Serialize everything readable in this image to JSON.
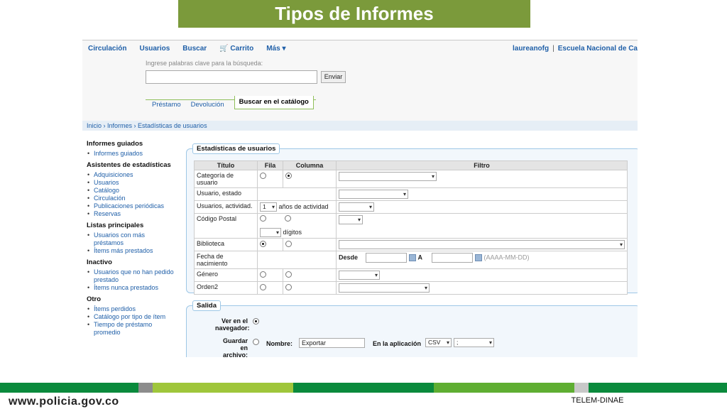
{
  "banner": {
    "title": "Tipos de Informes"
  },
  "topnav": {
    "links": [
      "Circulación",
      "Usuarios",
      "Buscar",
      "Carrito",
      "Más"
    ],
    "user": "laureanofg",
    "library": "Escuela Nacional de Ca"
  },
  "search": {
    "hint": "Ingrese palabras clave para la búsqueda:",
    "button": "Enviar",
    "tabs": [
      "Préstamo",
      "Devolución",
      "Buscar en el catálogo"
    ]
  },
  "breadcrumb": "Inicio › Informes › Estadísticas de usuarios",
  "sidebar": {
    "sections": [
      {
        "title": "Informes guiados",
        "items": [
          "Informes guiados"
        ]
      },
      {
        "title": "Asistentes de estadísticas",
        "items": [
          "Adquisiciones",
          "Usuarios",
          "Catálogo",
          "Circulación",
          "Publicaciones periódicas",
          "Reservas"
        ]
      },
      {
        "title": "Listas principales",
        "items": [
          "Usuarios con más",
          "préstamos",
          "Ítems más prestados"
        ]
      },
      {
        "title": "Inactivo",
        "items": [
          "Usuarios que no han pedido",
          "prestado",
          "Ítems nunca prestados"
        ]
      },
      {
        "title": "Otro",
        "items": [
          "Ítems perdidos",
          "Catálogo por tipo de ítem",
          "Tiempo de préstamo",
          "promedio"
        ]
      }
    ]
  },
  "stats": {
    "legend": "Estadísticas de usuarios",
    "headers": [
      "Título",
      "Fila",
      "Columna",
      "Filtro"
    ],
    "rows": {
      "categoria": "Categoría de usuario",
      "estado": "Usuario, estado",
      "actividad": "Usuarios, actividad.",
      "actividad_sel": "1",
      "actividad_txt": "años de actividad",
      "postal": "Código Postal",
      "postal_txt": "dígitos",
      "biblioteca": "Biblioteca",
      "nacimiento": "Fecha de nacimiento",
      "desde": "Desde",
      "a": "A",
      "formato": "(AAAA-MM-DD)",
      "genero": "Género",
      "orden2": "Orden2"
    }
  },
  "salida": {
    "legend": "Salida",
    "ver": "Ver en el",
    "ver2": "navegador:",
    "guardar": "Guardar en",
    "guardar2": "archivo:",
    "nombre_label": "Nombre:",
    "nombre_value": "Exportar",
    "app_label": "En la aplicación",
    "format": "CSV",
    "sep": ";"
  },
  "footer": {
    "url": "www.policia.gov.co",
    "tag": "TELEM-DINAE",
    "colors": [
      "#0a8a3c",
      "#8c8c8c",
      "#9fc63b",
      "#0a8a3c",
      "#5fae32",
      "#0a8a3c",
      "#c8c8c8",
      "#0a8a3c"
    ]
  }
}
